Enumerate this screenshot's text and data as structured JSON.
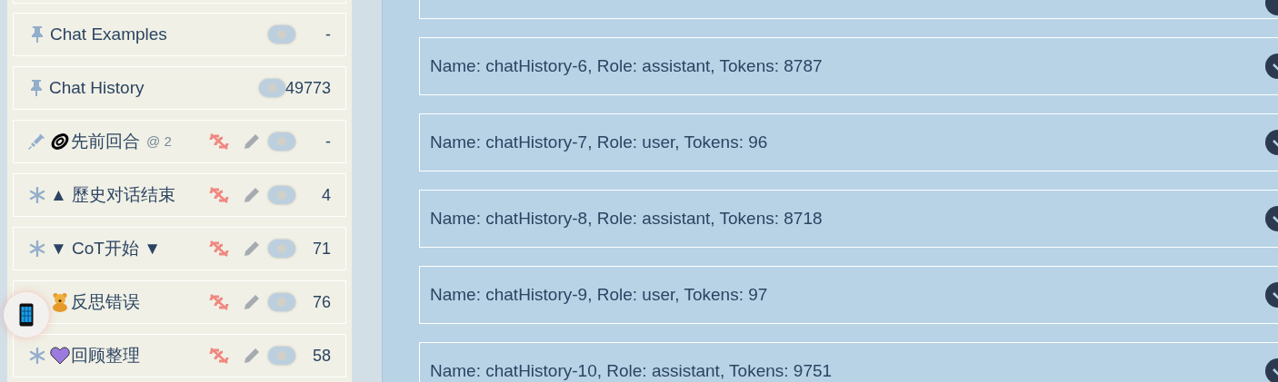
{
  "entries": [
    {
      "kind": "pin",
      "label": "Chat Examples",
      "on": false,
      "count": "-"
    },
    {
      "kind": "pin",
      "label": "Chat History",
      "on": false,
      "count": "49773"
    },
    {
      "kind": "syringe",
      "badge": {
        "kind": "rings"
      },
      "label": "先前回合",
      "depth": "@ 2",
      "on": false,
      "count": "-"
    },
    {
      "kind": "asterisk",
      "label": "▲ 歷史对话结束",
      "on": false,
      "count": "4"
    },
    {
      "kind": "asterisk",
      "label": "▼ CoT开始 ▼",
      "on": false,
      "count": "71"
    },
    {
      "kind": "hidden",
      "badge": {
        "kind": "bear"
      },
      "label": "反思错误",
      "on": false,
      "count": "76"
    },
    {
      "kind": "asterisk",
      "badge": {
        "kind": "heart"
      },
      "label": "回顾整理",
      "on": false,
      "count": "58"
    }
  ],
  "messages": [
    {
      "label": "Name: chatHistory-6, Role: assistant, Tokens: 8787",
      "expanded": false
    },
    {
      "label": "Name: chatHistory-7, Role: user, Tokens: 96",
      "expanded": false
    },
    {
      "label": "Name: chatHistory-8, Role: assistant, Tokens: 8718",
      "expanded": false
    },
    {
      "label": "Name: chatHistory-9, Role: user, Tokens: 97",
      "expanded": false
    },
    {
      "label": "Name: chatHistory-10, Role: assistant, Tokens: 9751",
      "expanded": false
    }
  ]
}
